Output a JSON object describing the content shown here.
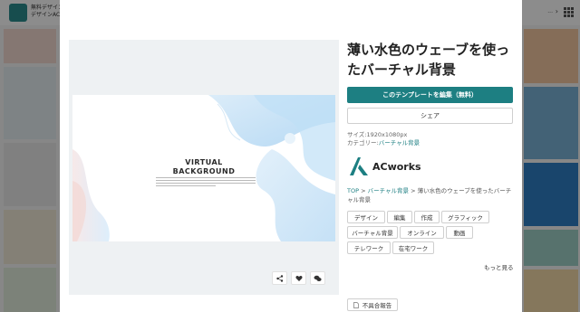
{
  "background": {
    "brand_line1": "無料デザイン",
    "brand_line2": "デザインAC",
    "header_right": "..."
  },
  "modal": {
    "title": "薄い水色のウェーブを使ったバーチャル背景",
    "edit_button": "このテンプレートを編集（無料）",
    "share_button": "シェア",
    "size_label": "サイズ:",
    "size_value": "1920x1080px",
    "category_label": "カテゴリー:",
    "category_value": "バーチャル背景",
    "creator": "ACworks",
    "breadcrumb": {
      "top": "TOP",
      "sep1": " > ",
      "category": "バーチャル背景",
      "sep2": " > ",
      "current": "薄い水色のウェーブを使ったバーチャル背景"
    },
    "tags": [
      "デザイン",
      "編集",
      "作成",
      "グラフィック",
      "バーチャル背景",
      "オンライン",
      "動画",
      "テレワーク",
      "在宅ワーク"
    ],
    "more_link": "もっと見る",
    "report_button": "不具合報告",
    "close_icon": "×"
  },
  "preview": {
    "title_line1": "VIRTUAL",
    "title_line2": "BACKGROUND"
  },
  "icons": {
    "share": "share-icon",
    "like": "heart-icon",
    "comment": "comment-icon"
  },
  "colors": {
    "accent": "#1d7f82",
    "overlay": "rgba(0,0,0,0.45)"
  }
}
